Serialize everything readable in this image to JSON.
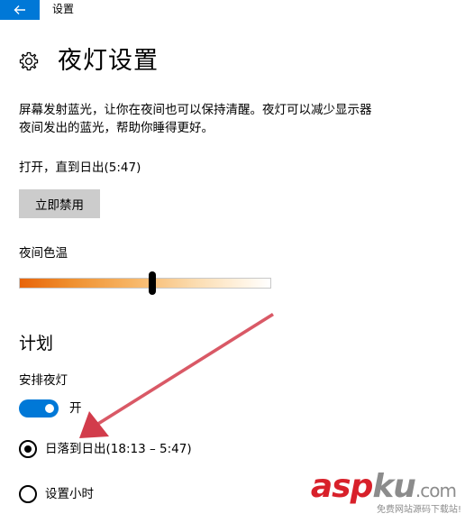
{
  "titlebar": {
    "app_title": "设置",
    "back_icon": "back-arrow-icon",
    "accent": "#0078d7"
  },
  "header": {
    "icon": "gear-icon",
    "title": "夜灯设置"
  },
  "description": {
    "line1": "屏幕发射蓝光，让你在夜间也可以保持清醒。夜灯可以减少显示器",
    "line2": "夜间发出的蓝光，帮助你睡得更好。"
  },
  "status_text": "打开，直到日出(5:47)",
  "disable_button_label": "立即禁用",
  "color_temperature": {
    "label": "夜间色温",
    "level": 0.53,
    "gradient": [
      "#e8640a",
      "#ffffff"
    ]
  },
  "plan": {
    "heading": "计划",
    "schedule_label": "安排夜灯",
    "toggle": {
      "on": true,
      "text": "开"
    },
    "options": [
      {
        "label": "日落到日出(18:13 – 5:47)",
        "selected": true
      },
      {
        "label": "设置小时",
        "selected": false
      }
    ]
  },
  "annotation": {
    "color": "#d23c4b"
  },
  "watermark": {
    "brand_asp": "asp",
    "brand_ku": "ku",
    "brand_domain": ".com",
    "tagline": "免费网站源码下载站!",
    "brand_color": "#d8202a"
  }
}
